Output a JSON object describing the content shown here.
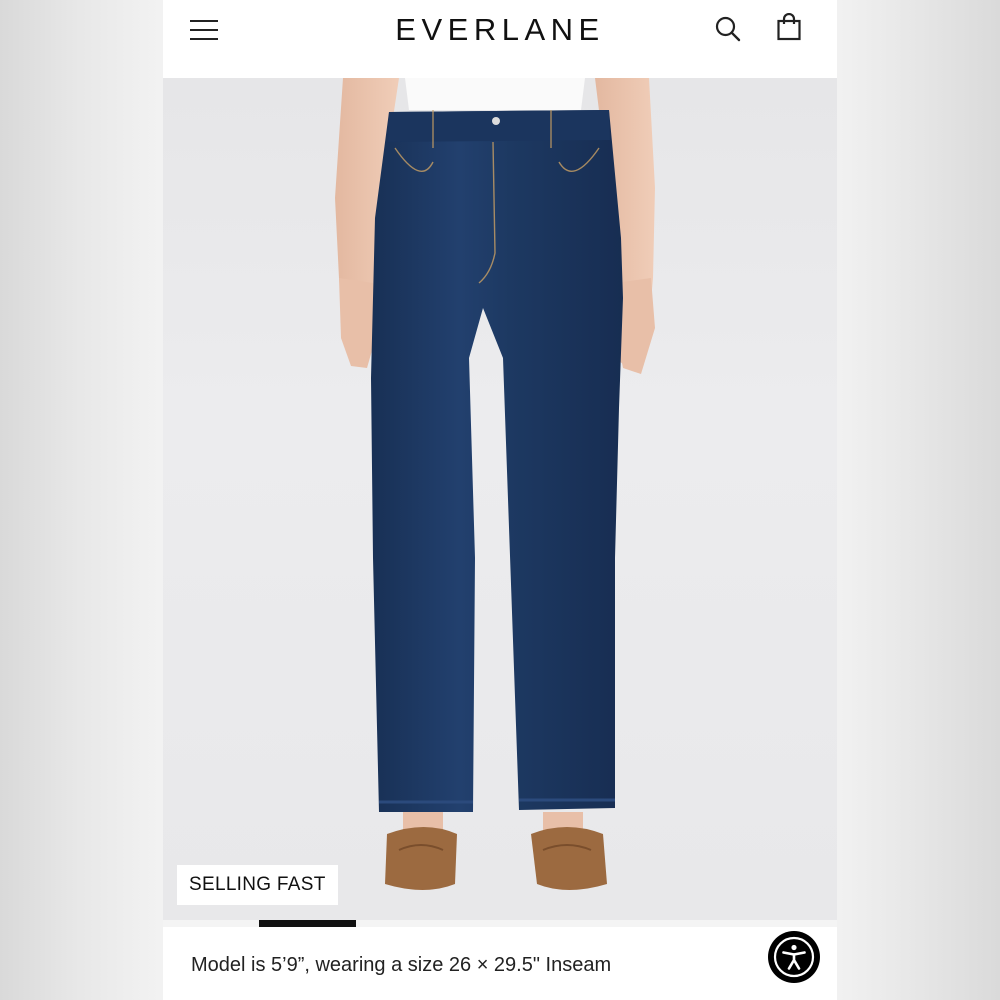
{
  "header": {
    "brand": "EVERLANE",
    "icons": {
      "menu": "hamburger-menu-icon",
      "search": "search-icon",
      "bag": "shopping-bag-icon"
    }
  },
  "product_image": {
    "badge": "SELLING FAST",
    "carousel": {
      "active_index": 1,
      "total_slides": 7
    }
  },
  "caption": {
    "model_info": "Model is 5’9”, wearing a size 26 × 29.5\" Inseam"
  },
  "accessibility": {
    "icon": "accessibility-person-icon"
  },
  "colors": {
    "denim": "#1f3a66",
    "denim_dark": "#182f55",
    "suede": "#9c6a40",
    "background": "#e9e9eb",
    "accent": "#000000"
  }
}
